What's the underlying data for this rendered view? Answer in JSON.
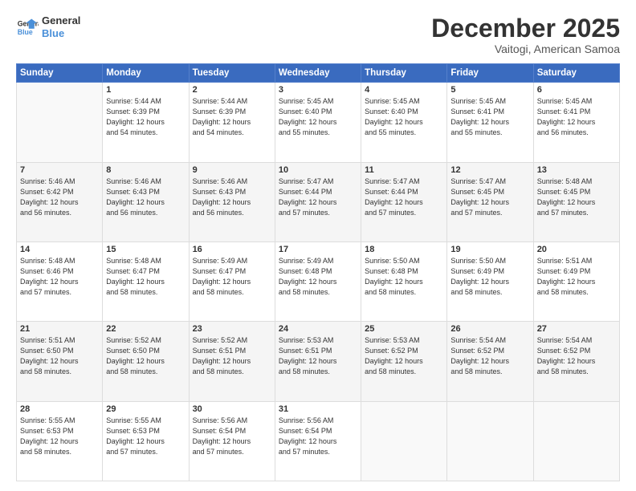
{
  "logo": {
    "line1": "General",
    "line2": "Blue"
  },
  "title": "December 2025",
  "subtitle": "Vaitogi, American Samoa",
  "days_of_week": [
    "Sunday",
    "Monday",
    "Tuesday",
    "Wednesday",
    "Thursday",
    "Friday",
    "Saturday"
  ],
  "weeks": [
    [
      {
        "day": "",
        "info": ""
      },
      {
        "day": "1",
        "info": "Sunrise: 5:44 AM\nSunset: 6:39 PM\nDaylight: 12 hours\nand 54 minutes."
      },
      {
        "day": "2",
        "info": "Sunrise: 5:44 AM\nSunset: 6:39 PM\nDaylight: 12 hours\nand 54 minutes."
      },
      {
        "day": "3",
        "info": "Sunrise: 5:45 AM\nSunset: 6:40 PM\nDaylight: 12 hours\nand 55 minutes."
      },
      {
        "day": "4",
        "info": "Sunrise: 5:45 AM\nSunset: 6:40 PM\nDaylight: 12 hours\nand 55 minutes."
      },
      {
        "day": "5",
        "info": "Sunrise: 5:45 AM\nSunset: 6:41 PM\nDaylight: 12 hours\nand 55 minutes."
      },
      {
        "day": "6",
        "info": "Sunrise: 5:45 AM\nSunset: 6:41 PM\nDaylight: 12 hours\nand 56 minutes."
      }
    ],
    [
      {
        "day": "7",
        "info": "Sunrise: 5:46 AM\nSunset: 6:42 PM\nDaylight: 12 hours\nand 56 minutes."
      },
      {
        "day": "8",
        "info": "Sunrise: 5:46 AM\nSunset: 6:43 PM\nDaylight: 12 hours\nand 56 minutes."
      },
      {
        "day": "9",
        "info": "Sunrise: 5:46 AM\nSunset: 6:43 PM\nDaylight: 12 hours\nand 56 minutes."
      },
      {
        "day": "10",
        "info": "Sunrise: 5:47 AM\nSunset: 6:44 PM\nDaylight: 12 hours\nand 57 minutes."
      },
      {
        "day": "11",
        "info": "Sunrise: 5:47 AM\nSunset: 6:44 PM\nDaylight: 12 hours\nand 57 minutes."
      },
      {
        "day": "12",
        "info": "Sunrise: 5:47 AM\nSunset: 6:45 PM\nDaylight: 12 hours\nand 57 minutes."
      },
      {
        "day": "13",
        "info": "Sunrise: 5:48 AM\nSunset: 6:45 PM\nDaylight: 12 hours\nand 57 minutes."
      }
    ],
    [
      {
        "day": "14",
        "info": "Sunrise: 5:48 AM\nSunset: 6:46 PM\nDaylight: 12 hours\nand 57 minutes."
      },
      {
        "day": "15",
        "info": "Sunrise: 5:48 AM\nSunset: 6:47 PM\nDaylight: 12 hours\nand 58 minutes."
      },
      {
        "day": "16",
        "info": "Sunrise: 5:49 AM\nSunset: 6:47 PM\nDaylight: 12 hours\nand 58 minutes."
      },
      {
        "day": "17",
        "info": "Sunrise: 5:49 AM\nSunset: 6:48 PM\nDaylight: 12 hours\nand 58 minutes."
      },
      {
        "day": "18",
        "info": "Sunrise: 5:50 AM\nSunset: 6:48 PM\nDaylight: 12 hours\nand 58 minutes."
      },
      {
        "day": "19",
        "info": "Sunrise: 5:50 AM\nSunset: 6:49 PM\nDaylight: 12 hours\nand 58 minutes."
      },
      {
        "day": "20",
        "info": "Sunrise: 5:51 AM\nSunset: 6:49 PM\nDaylight: 12 hours\nand 58 minutes."
      }
    ],
    [
      {
        "day": "21",
        "info": "Sunrise: 5:51 AM\nSunset: 6:50 PM\nDaylight: 12 hours\nand 58 minutes."
      },
      {
        "day": "22",
        "info": "Sunrise: 5:52 AM\nSunset: 6:50 PM\nDaylight: 12 hours\nand 58 minutes."
      },
      {
        "day": "23",
        "info": "Sunrise: 5:52 AM\nSunset: 6:51 PM\nDaylight: 12 hours\nand 58 minutes."
      },
      {
        "day": "24",
        "info": "Sunrise: 5:53 AM\nSunset: 6:51 PM\nDaylight: 12 hours\nand 58 minutes."
      },
      {
        "day": "25",
        "info": "Sunrise: 5:53 AM\nSunset: 6:52 PM\nDaylight: 12 hours\nand 58 minutes."
      },
      {
        "day": "26",
        "info": "Sunrise: 5:54 AM\nSunset: 6:52 PM\nDaylight: 12 hours\nand 58 minutes."
      },
      {
        "day": "27",
        "info": "Sunrise: 5:54 AM\nSunset: 6:52 PM\nDaylight: 12 hours\nand 58 minutes."
      }
    ],
    [
      {
        "day": "28",
        "info": "Sunrise: 5:55 AM\nSunset: 6:53 PM\nDaylight: 12 hours\nand 58 minutes."
      },
      {
        "day": "29",
        "info": "Sunrise: 5:55 AM\nSunset: 6:53 PM\nDaylight: 12 hours\nand 57 minutes."
      },
      {
        "day": "30",
        "info": "Sunrise: 5:56 AM\nSunset: 6:54 PM\nDaylight: 12 hours\nand 57 minutes."
      },
      {
        "day": "31",
        "info": "Sunrise: 5:56 AM\nSunset: 6:54 PM\nDaylight: 12 hours\nand 57 minutes."
      },
      {
        "day": "",
        "info": ""
      },
      {
        "day": "",
        "info": ""
      },
      {
        "day": "",
        "info": ""
      }
    ]
  ]
}
